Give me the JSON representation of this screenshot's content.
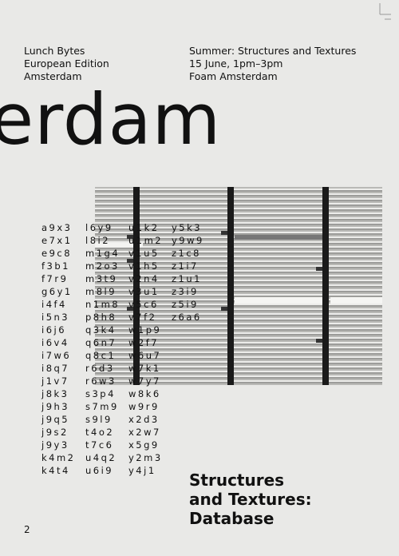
{
  "header": {
    "left_lines": [
      "Lunch Bytes",
      "European Edition",
      "Amsterdam"
    ],
    "right_lines": [
      "Summer: Structures and Textures",
      "15 June, 1pm–3pm",
      "Foam Amsterdam"
    ]
  },
  "big_title": "erdam",
  "codes": {
    "col1": [
      "a9x3",
      "e7x1",
      "e9c8",
      "f3b1",
      "f7r9",
      "g6y1",
      "i4f4",
      "i5n3",
      "i6j6",
      "i6v4",
      "i7w6",
      "i8q7",
      "j1v7",
      "j8k3",
      "j9h3",
      "j9q5",
      "j9s2",
      "j9y3",
      "k4m2",
      "k4t4"
    ],
    "col2": [
      "l6y9",
      "l8i2",
      "m1g4",
      "m2o3",
      "m3t9",
      "m8l9",
      "n1m8",
      "p8h8",
      "q3k4",
      "q6n7",
      "q8c1",
      "r6d3",
      "r6w3",
      "s3p4",
      "s7m9",
      "s9l9",
      "t4o2",
      "t7c6",
      "u4q2",
      "u6i9"
    ],
    "col3": [
      "u1k2",
      "u1m2",
      "v1u5",
      "v1h5",
      "v2n4",
      "v3u1",
      "v5c6",
      "v7f2",
      "w1p9",
      "w2f7",
      "w6u7",
      "w7k1",
      "w7y7",
      "w8k6",
      "w9r9",
      "x2d3",
      "x2w7",
      "x5g9",
      "y2m3",
      "y4j1"
    ],
    "col4": [
      "y5k3",
      "y9w9",
      "z1c8",
      "z1i7",
      "z1u1",
      "z3i9",
      "z5i9",
      "z6a6"
    ]
  },
  "bottom_title": [
    "Structures",
    "and Textures:",
    "Database"
  ],
  "page_number": "2",
  "colors": {
    "background": "#e9e9e7",
    "text": "#111111",
    "photo_base": "#b9b9b6"
  },
  "icons": [
    "crop-corner-icon"
  ]
}
